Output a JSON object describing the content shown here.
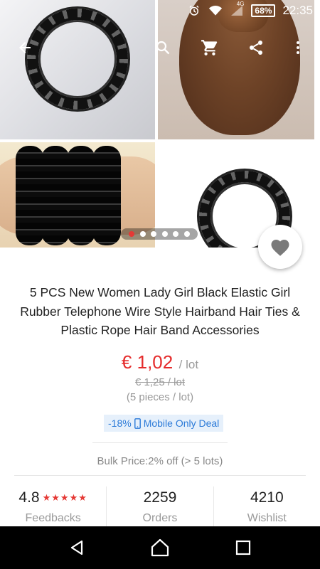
{
  "status_bar": {
    "network": "4G",
    "battery": "68%",
    "time": "22:35"
  },
  "gallery": {
    "dots_count": 6,
    "active_dot": 0
  },
  "product": {
    "title": "5 PCS New Women Lady Girl Black Elastic Girl Rubber Telephone Wire Style Hairband Hair Ties & Plastic Rope Hair Band Accessories",
    "price": "€ 1,02",
    "price_unit": "/ lot",
    "old_price": "€ 1,25 / lot",
    "pieces": "(5 pieces / lot)",
    "deal_discount": "-18%",
    "deal_label": "Mobile Only Deal",
    "bulk": "Bulk Price:2% off (> 5 lots)"
  },
  "stats": {
    "rating": "4.8",
    "stars": "★★★★★",
    "feedbacks_label": "Feedbacks",
    "orders": "2259",
    "orders_label": "Orders",
    "wishlist": "4210",
    "wishlist_label": "Wishlist"
  },
  "colors": {
    "price": "#e52b2b",
    "deal_bg": "#e6f0fb",
    "deal_text": "#2b7ad8",
    "active_dot": "#e53935"
  }
}
